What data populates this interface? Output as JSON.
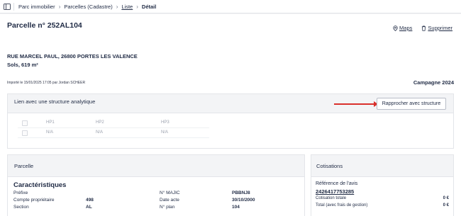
{
  "breadcrumb": {
    "items": [
      "Parc immobilier",
      "Parcelles (Cadastre)",
      "Liste",
      "Détail"
    ],
    "separator": "›"
  },
  "header": {
    "title": "Parcelle n° 252AL104",
    "actions": {
      "maps_label": "Maps",
      "delete_label": "Supprimer"
    }
  },
  "parcel_info": {
    "address": "RUE MARCEL PAUL, 26800 PORTES LES VALENCE",
    "surface": "Sols, 619 m²",
    "imported": "Importé le 15/01/2025 17:05 par Jordan SCHEER",
    "campaign": "Campagne 2024"
  },
  "link_panel": {
    "title": "Lien avec une structure analytique",
    "button_label": "Rapprocher avec structure",
    "columns": [
      "HP1",
      "HP2",
      "HP3"
    ],
    "row_values": [
      "N/A",
      "N/A",
      "N/A"
    ]
  },
  "parcelle_panel": {
    "title": "Parcelle",
    "section_title": "Caractéristiques",
    "left_fields": [
      {
        "label": "Préfixe",
        "value": ""
      },
      {
        "label": "Compte propriétaire",
        "value": "498"
      },
      {
        "label": "Section",
        "value": "AL"
      }
    ],
    "right_fields": [
      {
        "label": "N° MAJIC",
        "value": "PBBNJ8"
      },
      {
        "label": "Date acte",
        "value": "30/10/2000"
      },
      {
        "label": "N° plan",
        "value": "104"
      }
    ]
  },
  "cotisations_panel": {
    "title": "Cotisations",
    "ref_label": "Référence de l'avis",
    "ref_value": "2426417753285",
    "rows": [
      {
        "label": "Cotisation totale",
        "value": "0 €"
      },
      {
        "label": "Total (avec frais de gestion)",
        "value": "0 €"
      }
    ]
  },
  "colors": {
    "primary_text": "#1f2a44",
    "annotation_arrow": "#d9302c",
    "panel_header_bg": "#f3f4f6",
    "page_bg": "#f2f3f5"
  },
  "icons": [
    "sidebar-toggle-icon",
    "map-pin-icon",
    "trash-icon",
    "chevron-right-icon",
    "checkbox"
  ]
}
